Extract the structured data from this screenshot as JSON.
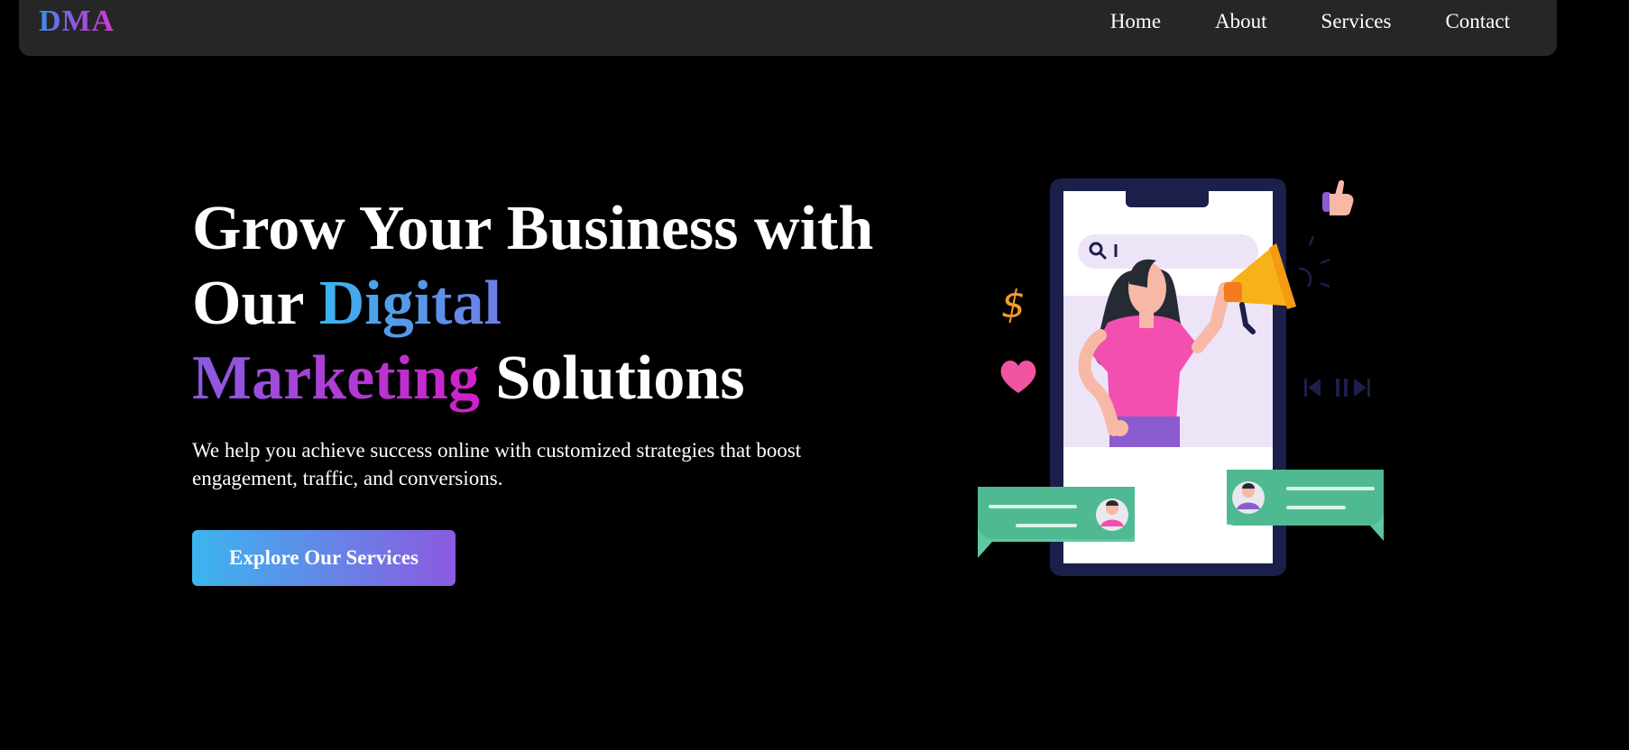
{
  "header": {
    "logo": "DMA",
    "nav": [
      {
        "label": "Home"
      },
      {
        "label": "About"
      },
      {
        "label": "Services"
      },
      {
        "label": "Contact"
      }
    ]
  },
  "hero": {
    "title_part1": "Grow Your Business with Our ",
    "title_highlight1": "Digital",
    "title_highlight2": "Marketing",
    "title_part2": " Solutions",
    "subtitle": "We help you achieve success online with customized strategies that boost engagement, traffic, and conversions.",
    "cta_label": "Explore Our Services"
  },
  "illustration": {
    "icons": [
      "phone-icon",
      "search-icon",
      "megaphone-icon",
      "thumbs-up-icon",
      "dollar-icon",
      "heart-icon",
      "media-controls-icon",
      "chat-bubble-icon",
      "avatar-icon"
    ],
    "colors": {
      "phone": "#1b1f4a",
      "screen": "#ffffff",
      "shirt": "#f24fb0",
      "skirt": "#8a5ccf",
      "megaphone": "#f7b21a",
      "bubble": "#5ec8a0",
      "heart": "#f2559f",
      "dollar": "#f39c2d"
    }
  }
}
